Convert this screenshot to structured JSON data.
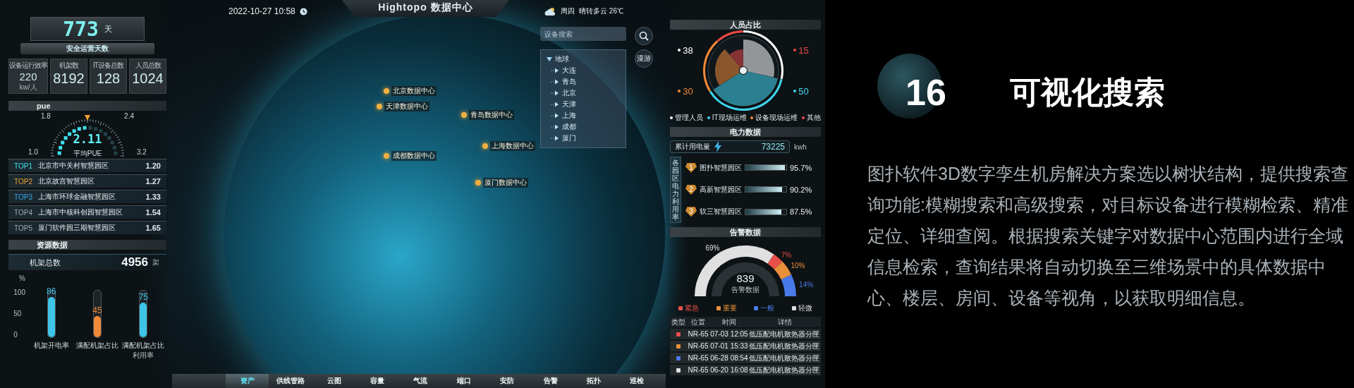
{
  "header": {
    "title": "Hightopo 数据中心",
    "datetime": "2022-10-27 10:58",
    "weekday": "周四",
    "weather": "晴转多云 26℃"
  },
  "left": {
    "safety": {
      "value": "773",
      "unit": "天",
      "label": "安全运营天数"
    },
    "stats": [
      {
        "label": "设备运行效率",
        "value": "220",
        "unit": "kw/人"
      },
      {
        "label": "机架数",
        "value": "8192"
      },
      {
        "label": "IT设备总数",
        "value": "128"
      },
      {
        "label": "人员总数",
        "value": "1024"
      }
    ],
    "pue": {
      "title": "pue",
      "value": "2.11",
      "caption": "平均PUE",
      "ticks": [
        "1.0",
        "1.8",
        "2.4",
        "3.2"
      ]
    },
    "ranking": [
      {
        "rank": "TOP1",
        "name": "北京市中关村智慧园区",
        "value": "1.20",
        "color": "#3fe0e8"
      },
      {
        "rank": "TOP2",
        "name": "北京故宫智慧园区",
        "value": "1.27",
        "color": "#f0a030"
      },
      {
        "rank": "TOP3",
        "name": "上海市环球金融智慧园区",
        "value": "1.33",
        "color": "#3aa8f0"
      },
      {
        "rank": "TOP4",
        "name": "上海市中核科创园智慧园区",
        "value": "1.54",
        "color": "#a0a8b0"
      },
      {
        "rank": "TOP5",
        "name": "厦门软件园三期智慧园区",
        "value": "1.65",
        "color": "#a0a8b0"
      }
    ],
    "resources": {
      "title": "资源数据",
      "total_label": "机架总数",
      "total": "4956",
      "total_unit": "架",
      "axis_unit": "%",
      "axis_ticks": [
        "100",
        "50",
        "0"
      ],
      "gauges": [
        {
          "name": "机架开电率",
          "value": "86",
          "level": 0.86,
          "color": "#3fc4e8"
        },
        {
          "name": "满配机架占比",
          "value": "45",
          "level": 0.45,
          "color": "#f08a3a"
        },
        {
          "name": "满配机架占比",
          "note": "利用率",
          "value": "75",
          "level": 0.75,
          "color": "#3fc4e8"
        }
      ]
    }
  },
  "map": {
    "search": {
      "placeholder": "设备搜索"
    },
    "roam_button": "漫游",
    "tree": {
      "label": "地球",
      "expanded": true,
      "children": [
        {
          "label": "大连"
        },
        {
          "label": "青岛"
        },
        {
          "label": "北京"
        },
        {
          "label": "天津"
        },
        {
          "label": "上海"
        },
        {
          "label": "成都"
        },
        {
          "label": "厦门"
        }
      ]
    },
    "sites": [
      {
        "label": "北京数据中心"
      },
      {
        "label": "天津数据中心"
      },
      {
        "label": "青岛数据中心"
      },
      {
        "label": "上海数据中心"
      },
      {
        "label": "成都数据中心"
      },
      {
        "label": "厦门数据中心"
      }
    ]
  },
  "right": {
    "personnel": {
      "title": "人员占比",
      "items": [
        {
          "name": "管理人员",
          "value": "38",
          "color": "#ffffff"
        },
        {
          "name": "IT现场运维",
          "value": "50",
          "color": "#3fd6f0"
        },
        {
          "name": "设备现场运维",
          "value": "30",
          "color": "#f08a3a"
        },
        {
          "name": "其他",
          "value": "15",
          "color": "#e84a4a"
        }
      ]
    },
    "power": {
      "title": "电力数据",
      "total_label": "累计用电量",
      "total": "73225",
      "unit": "kwh",
      "side_label": "各园区电力利用率",
      "parks": [
        {
          "rank": "1",
          "name": "图扑智慧园区",
          "level": 0.957,
          "value": "95.7%"
        },
        {
          "rank": "2",
          "name": "高新智慧园区",
          "level": 0.902,
          "value": "90.2%"
        },
        {
          "rank": "3",
          "name": "软三智慧园区",
          "level": 0.875,
          "value": "87.5%"
        }
      ]
    },
    "alarms": {
      "title": "告警数据",
      "total": "839",
      "caption": "告警数据",
      "levels": [
        {
          "name": "紧急",
          "share": "7%",
          "color": "#e8504a"
        },
        {
          "name": "重要",
          "share": "10%",
          "color": "#e8903a"
        },
        {
          "name": "一般",
          "share": "14%",
          "color": "#4a7ae8"
        },
        {
          "name": "轻微",
          "share": "69%",
          "color": "#e0e0e0"
        }
      ],
      "columns": [
        "类型",
        "位置",
        "时间",
        "详情"
      ],
      "rows": [
        {
          "color": "#e8504a",
          "position": "NR-65",
          "time": "07-03 12:05",
          "detail": "低压配电机散热器分匣"
        },
        {
          "color": "#e8903a",
          "position": "NR-65",
          "time": "07-01 15:33",
          "detail": "低压配电机散热器分匣"
        },
        {
          "color": "#4a7ae8",
          "position": "NR-65",
          "time": "06-28 08:54",
          "detail": "低压配电机散热器分匣"
        },
        {
          "color": "#e0e0e0",
          "position": "NR-65",
          "time": "06-20 16:08",
          "detail": "低压配电机散热器分匣"
        }
      ]
    }
  },
  "nav": [
    {
      "label": "资产",
      "selected": true
    },
    {
      "label": "供线管路",
      "selected": false
    },
    {
      "label": "云图",
      "selected": false
    },
    {
      "label": "容量",
      "selected": false
    },
    {
      "label": "气流",
      "selected": false
    },
    {
      "label": "端口",
      "selected": false
    },
    {
      "label": "安防",
      "selected": false
    },
    {
      "label": "告警",
      "selected": false
    },
    {
      "label": "拓扑",
      "selected": false
    },
    {
      "label": "巡检",
      "selected": false
    }
  ],
  "feature": {
    "number": "16",
    "title": "可视化搜索",
    "description": "图扑软件3D数字孪生机房解决方案选以树状结构，提供搜索查询功能:模糊搜索和高级搜索，对目标设备进行模糊检索、精准定位、详细查阅。根据搜索关键字对数据中心范围内进行全域信息检索，查询结果将自动切换至三维场景中的具体数据中心、楼层、房间、设备等视角，以获取明细信息。"
  }
}
